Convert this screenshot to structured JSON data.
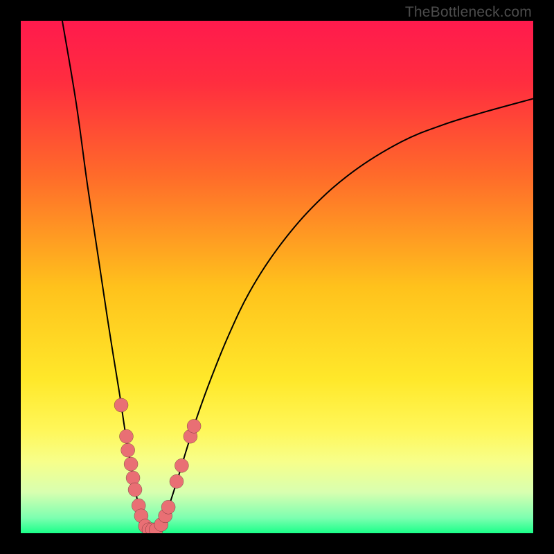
{
  "watermark": {
    "text": "TheBottleneck.com"
  },
  "colors": {
    "frame": "#000000",
    "gradient_stops": [
      {
        "offset": 0.0,
        "color": "#ff1a4d"
      },
      {
        "offset": 0.12,
        "color": "#ff2d3f"
      },
      {
        "offset": 0.3,
        "color": "#ff6a2a"
      },
      {
        "offset": 0.52,
        "color": "#ffc21c"
      },
      {
        "offset": 0.7,
        "color": "#ffe82a"
      },
      {
        "offset": 0.8,
        "color": "#fff75a"
      },
      {
        "offset": 0.86,
        "color": "#f7ff8a"
      },
      {
        "offset": 0.92,
        "color": "#d8ffb0"
      },
      {
        "offset": 0.97,
        "color": "#7dffb0"
      },
      {
        "offset": 1.0,
        "color": "#1aff89"
      }
    ],
    "curve_stroke": "#000000",
    "marker_fill": "#e96f74",
    "marker_stroke": "#000000"
  },
  "chart_data": {
    "type": "line",
    "title": "",
    "xlabel": "",
    "ylabel": "",
    "xlim": [
      0,
      100
    ],
    "ylim": [
      0,
      100
    ],
    "grid": false,
    "series": [
      {
        "name": "left-branch",
        "x": [
          8.1,
          10.8,
          13.0,
          15.1,
          16.9,
          18.2,
          19.4,
          20.3,
          21.1,
          21.8,
          22.4,
          23.0,
          23.5,
          23.9
        ],
        "y": [
          100,
          84,
          68,
          54,
          42,
          33.8,
          26.4,
          20.3,
          15.5,
          11.5,
          8.1,
          5.4,
          3.1,
          1.6
        ]
      },
      {
        "name": "valley",
        "x": [
          24.3,
          25.0,
          25.7,
          26.4,
          27.0
        ],
        "y": [
          0.5,
          0.0,
          0.0,
          0.3,
          0.7
        ]
      },
      {
        "name": "right-branch",
        "x": [
          27.7,
          28.6,
          29.6,
          30.8,
          32.4,
          34.5,
          37.2,
          40.5,
          44.6,
          50.0,
          56.8,
          64.9,
          74.3,
          82.4,
          90.5,
          100.0
        ],
        "y": [
          2.0,
          4.4,
          7.4,
          11.2,
          16.5,
          23.0,
          30.4,
          38.5,
          47.0,
          55.4,
          63.5,
          70.6,
          76.4,
          79.7,
          82.2,
          84.8
        ]
      }
    ],
    "markers": [
      {
        "x": 19.6,
        "y": 25.0,
        "r": 1.35
      },
      {
        "x": 20.6,
        "y": 18.9,
        "r": 1.35
      },
      {
        "x": 20.9,
        "y": 16.2,
        "r": 1.35
      },
      {
        "x": 21.5,
        "y": 13.5,
        "r": 1.35
      },
      {
        "x": 21.9,
        "y": 10.8,
        "r": 1.35
      },
      {
        "x": 22.3,
        "y": 8.5,
        "r": 1.35
      },
      {
        "x": 23.0,
        "y": 5.4,
        "r": 1.35
      },
      {
        "x": 23.5,
        "y": 3.4,
        "r": 1.35
      },
      {
        "x": 24.3,
        "y": 1.4,
        "r": 1.35
      },
      {
        "x": 25.0,
        "y": 0.7,
        "r": 1.35
      },
      {
        "x": 25.7,
        "y": 0.7,
        "r": 1.35
      },
      {
        "x": 26.4,
        "y": 0.7,
        "r": 1.35
      },
      {
        "x": 27.4,
        "y": 1.7,
        "r": 1.35
      },
      {
        "x": 28.2,
        "y": 3.4,
        "r": 1.35
      },
      {
        "x": 28.8,
        "y": 5.1,
        "r": 1.35
      },
      {
        "x": 30.4,
        "y": 10.1,
        "r": 1.35
      },
      {
        "x": 31.4,
        "y": 13.2,
        "r": 1.35
      },
      {
        "x": 33.1,
        "y": 18.9,
        "r": 1.35
      },
      {
        "x": 33.8,
        "y": 20.9,
        "r": 1.35
      }
    ]
  }
}
